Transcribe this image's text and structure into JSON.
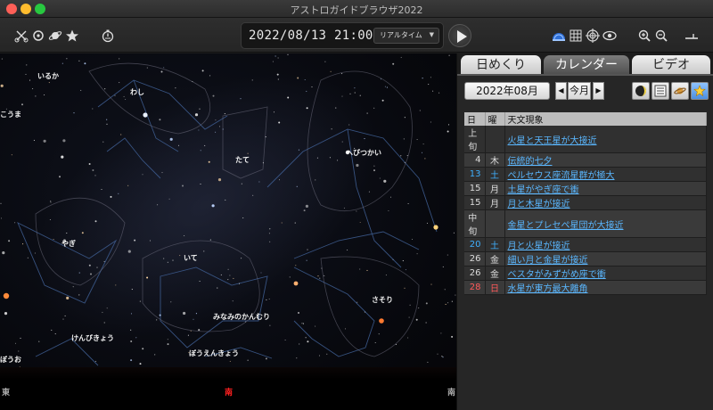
{
  "window": {
    "title": "アストロガイドブラウザ2022"
  },
  "toolbar": {
    "icons_left": [
      "scissors-icon",
      "galaxy-icon",
      "planet-icon",
      "star-icon",
      "timer-icon"
    ],
    "datetime": "2022/08/13 21:00:00",
    "mode_select": "リアルタイム",
    "icons_right": [
      "dome-icon",
      "grid-icon",
      "crosshair-icon",
      "constellation-icon",
      "zoom-in-icon",
      "zoom-out-icon",
      "horizon-icon"
    ]
  },
  "sky": {
    "constellations": [
      "いるか",
      "わし",
      "たて",
      "へびつかい",
      "やぎ",
      "いて",
      "みなみのかんむり",
      "けんびきょう",
      "ぼうえんきょう",
      "さそり",
      "こうま",
      "ぼうお"
    ],
    "directions": {
      "left": "東",
      "center": "南",
      "right": "南"
    }
  },
  "panel": {
    "tabs": [
      "日めくり",
      "カレンダー",
      "ビデオ"
    ],
    "active_tab": "カレンダー",
    "month": "2022年08月",
    "prev": "◀",
    "next": "▶",
    "this_month": "今月",
    "table": {
      "headers": [
        "日",
        "曜",
        "天文現象"
      ],
      "rows": [
        {
          "day": "上旬",
          "weekday": "",
          "event": "火星と天王星が大接近",
          "kind": "period"
        },
        {
          "day": "4",
          "weekday": "木",
          "event": "伝統的七夕",
          "kind": "weekday"
        },
        {
          "day": "13",
          "weekday": "土",
          "event": "ペルセウス座流星群が極大",
          "kind": "sat"
        },
        {
          "day": "15",
          "weekday": "月",
          "event": "土星がやぎ座で衝",
          "kind": "weekday"
        },
        {
          "day": "15",
          "weekday": "月",
          "event": "月と木星が接近",
          "kind": "weekday"
        },
        {
          "day": "中旬",
          "weekday": "",
          "event": "金星とプレセペ星団が大接近",
          "kind": "period"
        },
        {
          "day": "20",
          "weekday": "土",
          "event": "月と火星が接近",
          "kind": "sat"
        },
        {
          "day": "26",
          "weekday": "金",
          "event": "細い月と金星が接近",
          "kind": "weekday"
        },
        {
          "day": "26",
          "weekday": "金",
          "event": "ベスタがみずがめ座で衝",
          "kind": "weekday"
        },
        {
          "day": "28",
          "weekday": "日",
          "event": "水星が東方最大離角",
          "kind": "sun"
        }
      ]
    }
  },
  "colors": {
    "link": "#5ab7ff",
    "saturday": "#3fb0ff",
    "sunday": "#ff5a5a",
    "south_marker": "#ff2020"
  }
}
